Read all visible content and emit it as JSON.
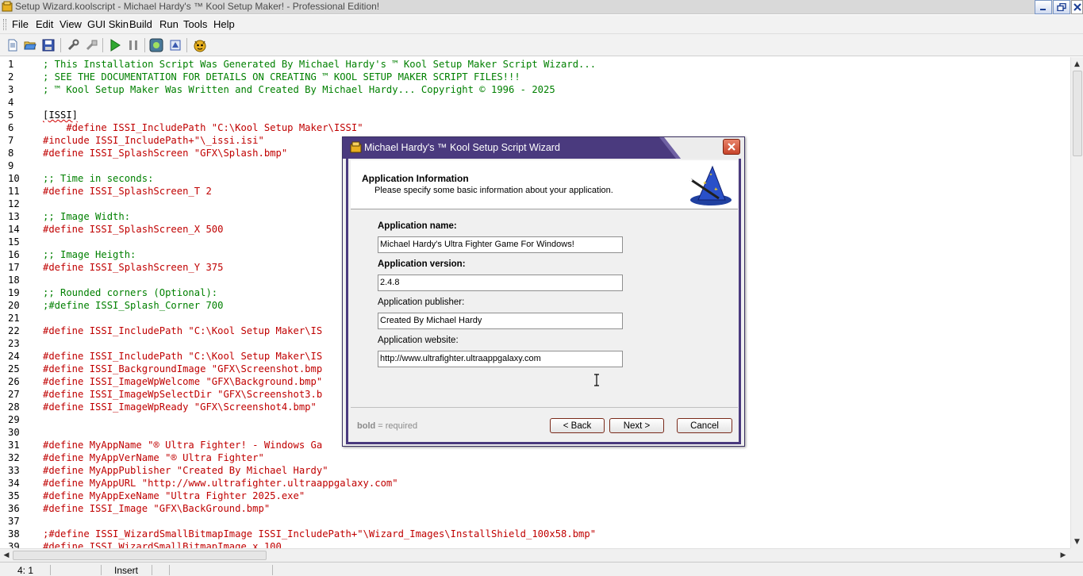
{
  "window": {
    "title": "Setup Wizard.koolscript - Michael Hardy's ™ Kool Setup Maker! - Professional Edition!"
  },
  "menu": [
    "File",
    "Edit",
    "View",
    "GUI Skin",
    "Build",
    "Run",
    "Tools",
    "Help"
  ],
  "toolbar": {
    "icons": [
      "new-file-icon",
      "open-folder-icon",
      "save-icon",
      "wrench-icon",
      "compile-icon",
      "run-icon",
      "pause-icon",
      "stop-icon",
      "template-icon",
      "app-mascot-icon"
    ]
  },
  "editor": {
    "lines": [
      {
        "n": "1",
        "code": "; This Installation Script Was Generated By Michael Hardy's ™ Kool Setup Maker Script Wizard...",
        "kind": "comment"
      },
      {
        "n": "2",
        "code": "; SEE THE DOCUMENTATION FOR DETAILS ON CREATING ™ KOOL SETUP MAKER SCRIPT FILES!!!",
        "kind": "comment"
      },
      {
        "n": "3",
        "code": "; ™ Kool Setup Maker Was Written and Created By Michael Hardy... Copyright © 1996 - 2025",
        "kind": "comment"
      },
      {
        "n": "4",
        "code": "",
        "kind": "plain"
      },
      {
        "n": "5",
        "code": "[ISSI]",
        "kind": "section"
      },
      {
        "n": "6",
        "code": "    #define ISSI_IncludePath \"C:\\Kool Setup Maker\\ISSI\"",
        "kind": "define"
      },
      {
        "n": "7",
        "code": "#include ISSI_IncludePath+\"\\_issi.isi\"",
        "kind": "define"
      },
      {
        "n": "8",
        "code": "#define ISSI_SplashScreen \"GFX\\Splash.bmp\"",
        "kind": "define"
      },
      {
        "n": "9",
        "code": "",
        "kind": "plain"
      },
      {
        "n": "10",
        "code": ";; Time in seconds:",
        "kind": "comment"
      },
      {
        "n": "11",
        "code": "#define ISSI_SplashScreen_T 2",
        "kind": "define"
      },
      {
        "n": "12",
        "code": "",
        "kind": "plain"
      },
      {
        "n": "13",
        "code": ";; Image Width:",
        "kind": "comment"
      },
      {
        "n": "14",
        "code": "#define ISSI_SplashScreen_X 500",
        "kind": "define"
      },
      {
        "n": "15",
        "code": "",
        "kind": "plain"
      },
      {
        "n": "16",
        "code": ";; Image Heigth:",
        "kind": "comment"
      },
      {
        "n": "17",
        "code": "#define ISSI_SplashScreen_Y 375",
        "kind": "define"
      },
      {
        "n": "18",
        "code": "",
        "kind": "plain"
      },
      {
        "n": "19",
        "code": ";; Rounded corners (Optional):",
        "kind": "comment"
      },
      {
        "n": "20",
        "code": ";#define ISSI_Splash_Corner 700",
        "kind": "comment"
      },
      {
        "n": "21",
        "code": "",
        "kind": "plain"
      },
      {
        "n": "22",
        "code": "#define ISSI_IncludePath \"C:\\Kool Setup Maker\\IS",
        "kind": "define"
      },
      {
        "n": "23",
        "code": "",
        "kind": "plain"
      },
      {
        "n": "24",
        "code": "#define ISSI_IncludePath \"C:\\Kool Setup Maker\\IS",
        "kind": "define"
      },
      {
        "n": "25",
        "code": "#define ISSI_BackgroundImage \"GFX\\Screenshot.bmp",
        "kind": "define"
      },
      {
        "n": "26",
        "code": "#define ISSI_ImageWpWelcome \"GFX\\Background.bmp\"",
        "kind": "define"
      },
      {
        "n": "27",
        "code": "#define ISSI_ImageWpSelectDir \"GFX\\Screenshot3.b",
        "kind": "define"
      },
      {
        "n": "28",
        "code": "#define ISSI_ImageWpReady \"GFX\\Screenshot4.bmp\"",
        "kind": "define"
      },
      {
        "n": "29",
        "code": "",
        "kind": "plain"
      },
      {
        "n": "30",
        "code": "",
        "kind": "plain"
      },
      {
        "n": "31",
        "code": "#define MyAppName \"® Ultra Fighter! - Windows Ga",
        "kind": "define"
      },
      {
        "n": "32",
        "code": "#define MyAppVerName \"® Ultra Fighter\"",
        "kind": "define"
      },
      {
        "n": "33",
        "code": "#define MyAppPublisher \"Created By Michael Hardy\"",
        "kind": "define"
      },
      {
        "n": "34",
        "code": "#define MyAppURL \"http://www.ultrafighter.ultraappgalaxy.com\"",
        "kind": "define"
      },
      {
        "n": "35",
        "code": "#define MyAppExeName \"Ultra Fighter 2025.exe\"",
        "kind": "define"
      },
      {
        "n": "36",
        "code": "#define ISSI_Image \"GFX\\BackGround.bmp\"",
        "kind": "define"
      },
      {
        "n": "37",
        "code": "",
        "kind": "plain"
      },
      {
        "n": "38",
        "code": ";#define ISSI_WizardSmallBitmapImage ISSI_IncludePath+\"\\Wizard_Images\\InstallShield_100x58.bmp\"",
        "kind": "define"
      },
      {
        "n": "39",
        "code": "#define ISSI_WizardSmallBitmapImage_x 100",
        "kind": "define"
      }
    ]
  },
  "statusbar": {
    "position": "4:  1",
    "mode": "Insert"
  },
  "dialog": {
    "title": "Michael Hardy's ™ Kool Setup Script Wizard",
    "heading": "Application Information",
    "subheading": "Please specify some basic information about your application.",
    "fields": [
      {
        "label": "Application name:",
        "value": "Michael Hardy's Ultra Fighter Game For Windows!",
        "required": true
      },
      {
        "label": "Application version:",
        "value": "2.4.8",
        "required": true
      },
      {
        "label": "Application publisher:",
        "value": "Created By Michael Hardy",
        "required": false
      },
      {
        "label": "Application website:",
        "value": "http://www.ultrafighter.ultraappgalaxy.com",
        "required": false
      }
    ],
    "legend_bold": "bold",
    "legend_rest": " = required",
    "buttons": {
      "back": "< Back",
      "next": "Next >",
      "cancel": "Cancel"
    }
  },
  "colors": {
    "comment": "#008000",
    "define": "#c00000",
    "dialog_titlebar": "#4a3a7e",
    "close_button": "#c8442a"
  }
}
